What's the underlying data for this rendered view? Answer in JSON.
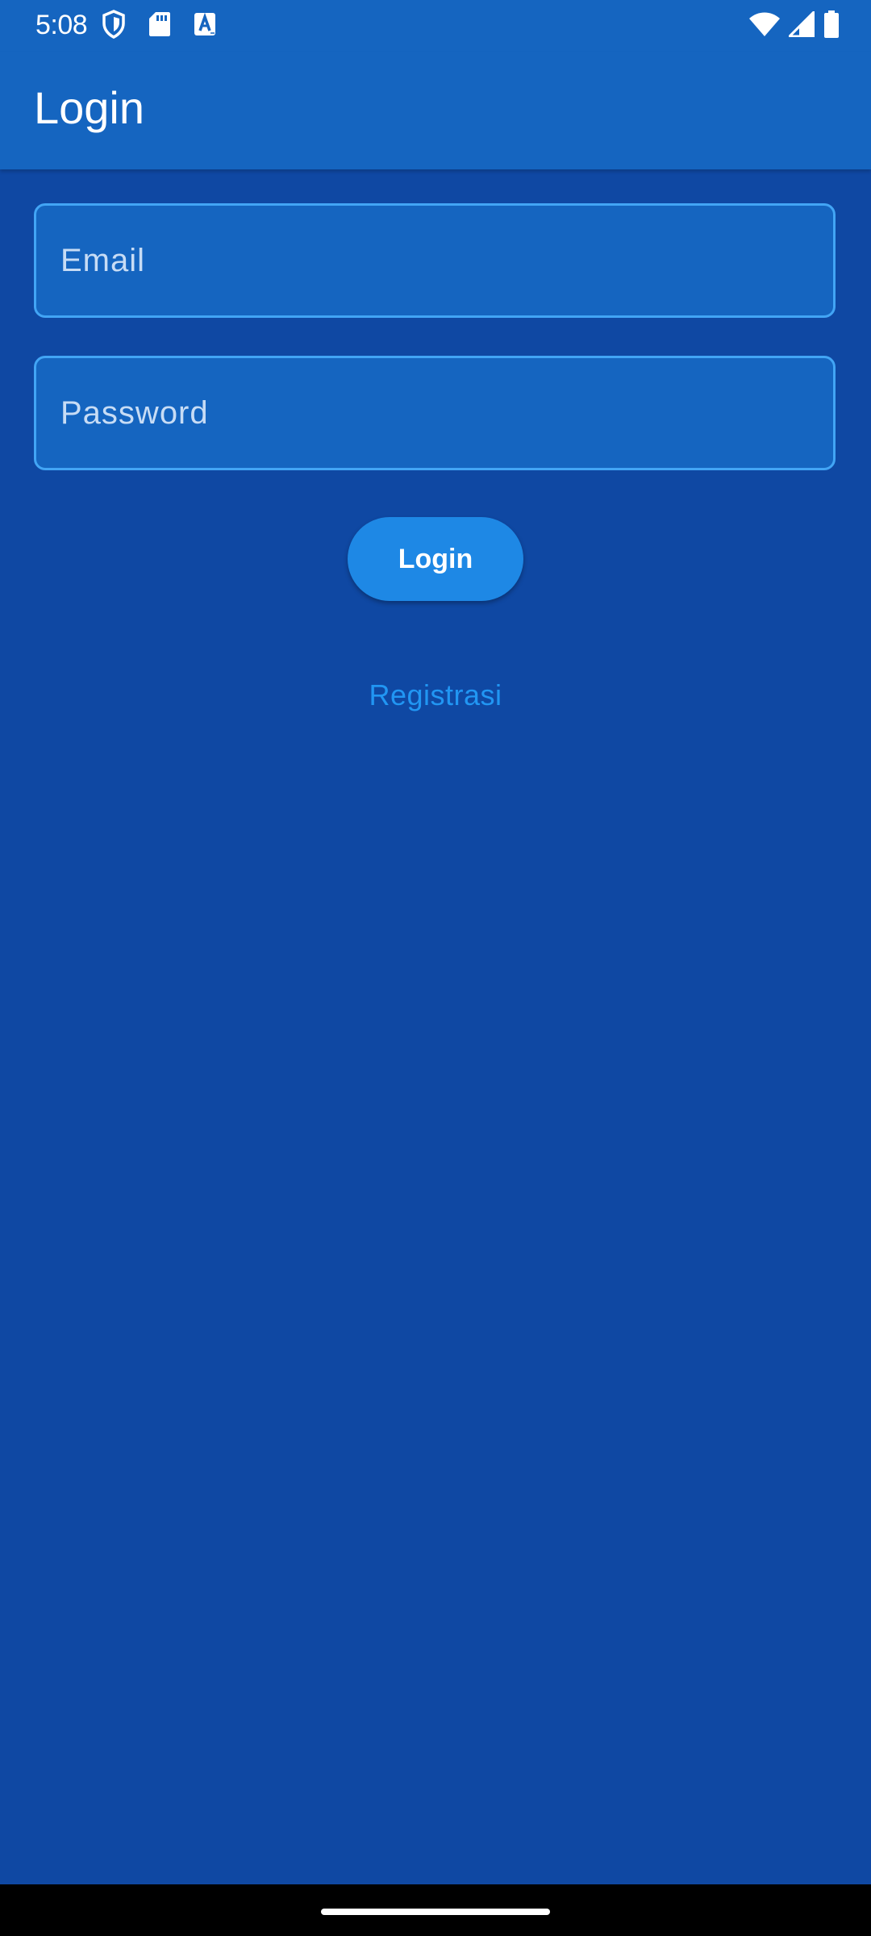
{
  "status_bar": {
    "time": "5:08",
    "left_icons": [
      "shield-icon",
      "sd-card-icon",
      "font-a-icon"
    ],
    "right_icons": [
      "wifi-icon",
      "cell-signal-icon",
      "battery-icon"
    ]
  },
  "app_bar": {
    "title": "Login",
    "background": "#1565c0"
  },
  "form": {
    "email": {
      "placeholder": "Email",
      "value": ""
    },
    "password": {
      "placeholder": "Password",
      "value": ""
    },
    "login_label": "Login",
    "register_label": "Registrasi"
  },
  "colors": {
    "background": "#0f48a3",
    "field_border": "#42a5f5",
    "button": "#1e88e5",
    "link": "#2196f3"
  }
}
